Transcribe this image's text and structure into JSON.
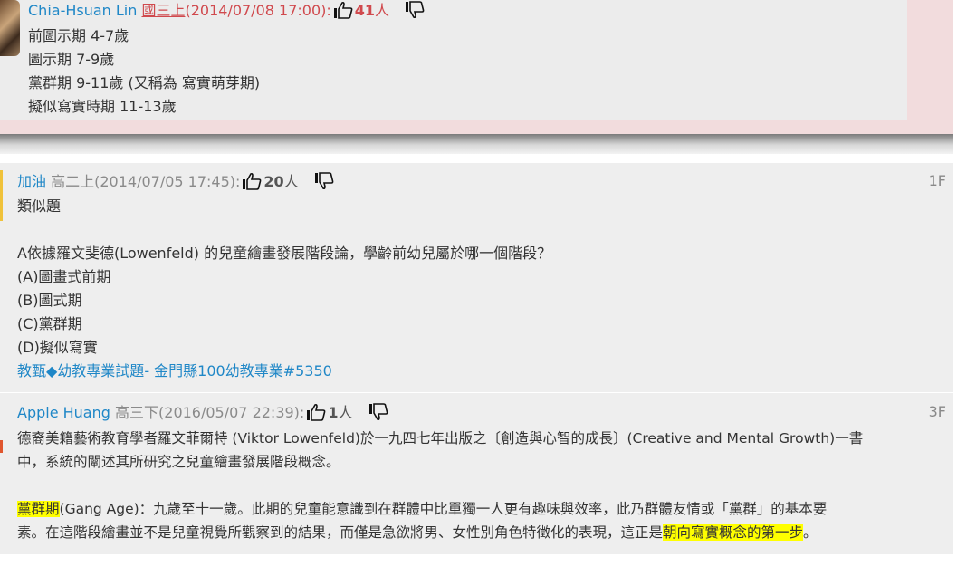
{
  "top_comment": {
    "author": "Chia-Hsuan Lin",
    "grade": "國三上",
    "date": "(2014/07/08 17:00):",
    "likes": "41",
    "people_unit": "人",
    "lines": [
      "前圖示期 4-7歲",
      "圖示期 7-9歲",
      "黨群期 9-11歲 (又稱為 寫實萌芽期)",
      "擬似寫實時期 11-13歲"
    ]
  },
  "post1": {
    "author": "加油",
    "grade": "高二上",
    "date": "(2014/07/05 17:45):",
    "likes": "20",
    "people_unit": "人",
    "floor": "1F",
    "lines": [
      "類似題",
      "A依據羅文斐德(Lowenfeld) 的兒童繪畫發展階段論，學齡前幼兒屬於哪一個階段？",
      "(A)圖畫式前期",
      "(B)圖式期",
      "(C)黨群期",
      "(D)擬似寫實"
    ],
    "link_a": "教甄◆幼教專業試題",
    "link_sep": "- ",
    "link_b": "金門縣100幼教專業#5350"
  },
  "post3": {
    "author": "Apple Huang",
    "grade": "高三下",
    "date": "(2016/05/07 22:39):",
    "likes": "1",
    "people_unit": "人",
    "floor": "3F",
    "para1_line1": "德裔美籍藝術教育學者羅文菲爾特 (Viktor Lowenfeld)於一九四七年出版之〔創造與心智的成長〕(Creative and Mental Growth)一書",
    "para1_line2": "中，系統的闡述其所研究之兒童繪畫發展階段概念。",
    "para2_hl1": "黨群期",
    "para2_line1_rest": "(Gang Age)：九歲至十一歲。此期的兒童能意識到在群體中比單獨一人更有趣味與效率，此乃群體友情或「黨群」的基本要",
    "para2_line2_pre": "素。在這階段繪畫並不是兒童視覺所觀察到的結果，而僅是急欲將男、女性別角色特徵化的表現，這正是",
    "para2_hl2": "朝向寫實概念的第一步",
    "para2_line2_end": "。"
  },
  "colors": {
    "author": "#1f87c7",
    "highlight": "#ffff00",
    "popup_bg": "#f2dcdd",
    "accent_bar": "#f0c23a"
  },
  "icons": {
    "like": "thumbs-up-icon",
    "dislike": "thumbs-down-icon"
  }
}
